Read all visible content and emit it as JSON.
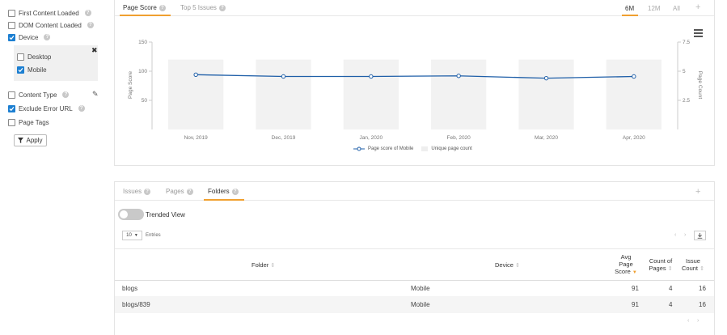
{
  "sidebar": {
    "items": [
      {
        "label": "First Content Loaded",
        "checked": false
      },
      {
        "label": "DOM Content Loaded",
        "checked": false
      },
      {
        "label": "Device",
        "checked": true
      }
    ],
    "device_options": [
      {
        "label": "Desktop",
        "checked": false
      },
      {
        "label": "Mobile",
        "checked": true
      }
    ],
    "items2": [
      {
        "label": "Content Type",
        "checked": false
      },
      {
        "label": "Exclude Error URL",
        "checked": true
      },
      {
        "label": "Page Tags",
        "checked": false
      }
    ],
    "apply_label": "Apply"
  },
  "chart_card": {
    "tabs": [
      "Page Score",
      "Top 5 Issues"
    ],
    "active_tab": "Page Score",
    "ranges": [
      "6M",
      "12M",
      "All"
    ],
    "active_range": "6M"
  },
  "chart_data": {
    "type": "line",
    "categories": [
      "Nov, 2019",
      "Dec, 2019",
      "Jan, 2020",
      "Feb, 2020",
      "Mar, 2020",
      "Apr, 2020"
    ],
    "series": [
      {
        "name": "Page score of Mobile",
        "type": "line",
        "values": [
          94,
          91,
          91,
          92,
          88,
          91
        ],
        "color": "#1f5fa8"
      },
      {
        "name": "Unique page count",
        "type": "bar",
        "values": [
          6,
          6,
          6,
          6,
          6,
          6
        ],
        "color": "#f2f2f2"
      }
    ],
    "ylabel": "Page Score",
    "y2label": "Page Count",
    "ylim": [
      0,
      150
    ],
    "yticks": [
      "150",
      "100",
      "50"
    ],
    "y2lim": [
      0,
      7.5
    ],
    "y2ticks": [
      "7.5",
      "5",
      "2.5"
    ],
    "legend_position": "bottom"
  },
  "table_card": {
    "tabs": [
      "Issues",
      "Pages",
      "Folders"
    ],
    "active_tab": "Folders",
    "trended_label": "Trended View",
    "entries_value": "10",
    "entries_label": "Entries",
    "columns": {
      "folder": "Folder",
      "device": "Device",
      "avg_score": [
        "Avg",
        "Page",
        "Score"
      ],
      "count_pages": [
        "Count of",
        "Pages"
      ],
      "issue_count": [
        "Issue",
        "Count"
      ]
    },
    "rows": [
      {
        "folder": "blogs",
        "device": "Mobile",
        "avg": "91",
        "pages": "4",
        "issues": "16"
      },
      {
        "folder": "blogs/839",
        "device": "Mobile",
        "avg": "91",
        "pages": "4",
        "issues": "16"
      }
    ]
  },
  "colors": {
    "accent": "#f0a030",
    "checkbox": "#1c7fd1",
    "line": "#1f5fa8"
  }
}
